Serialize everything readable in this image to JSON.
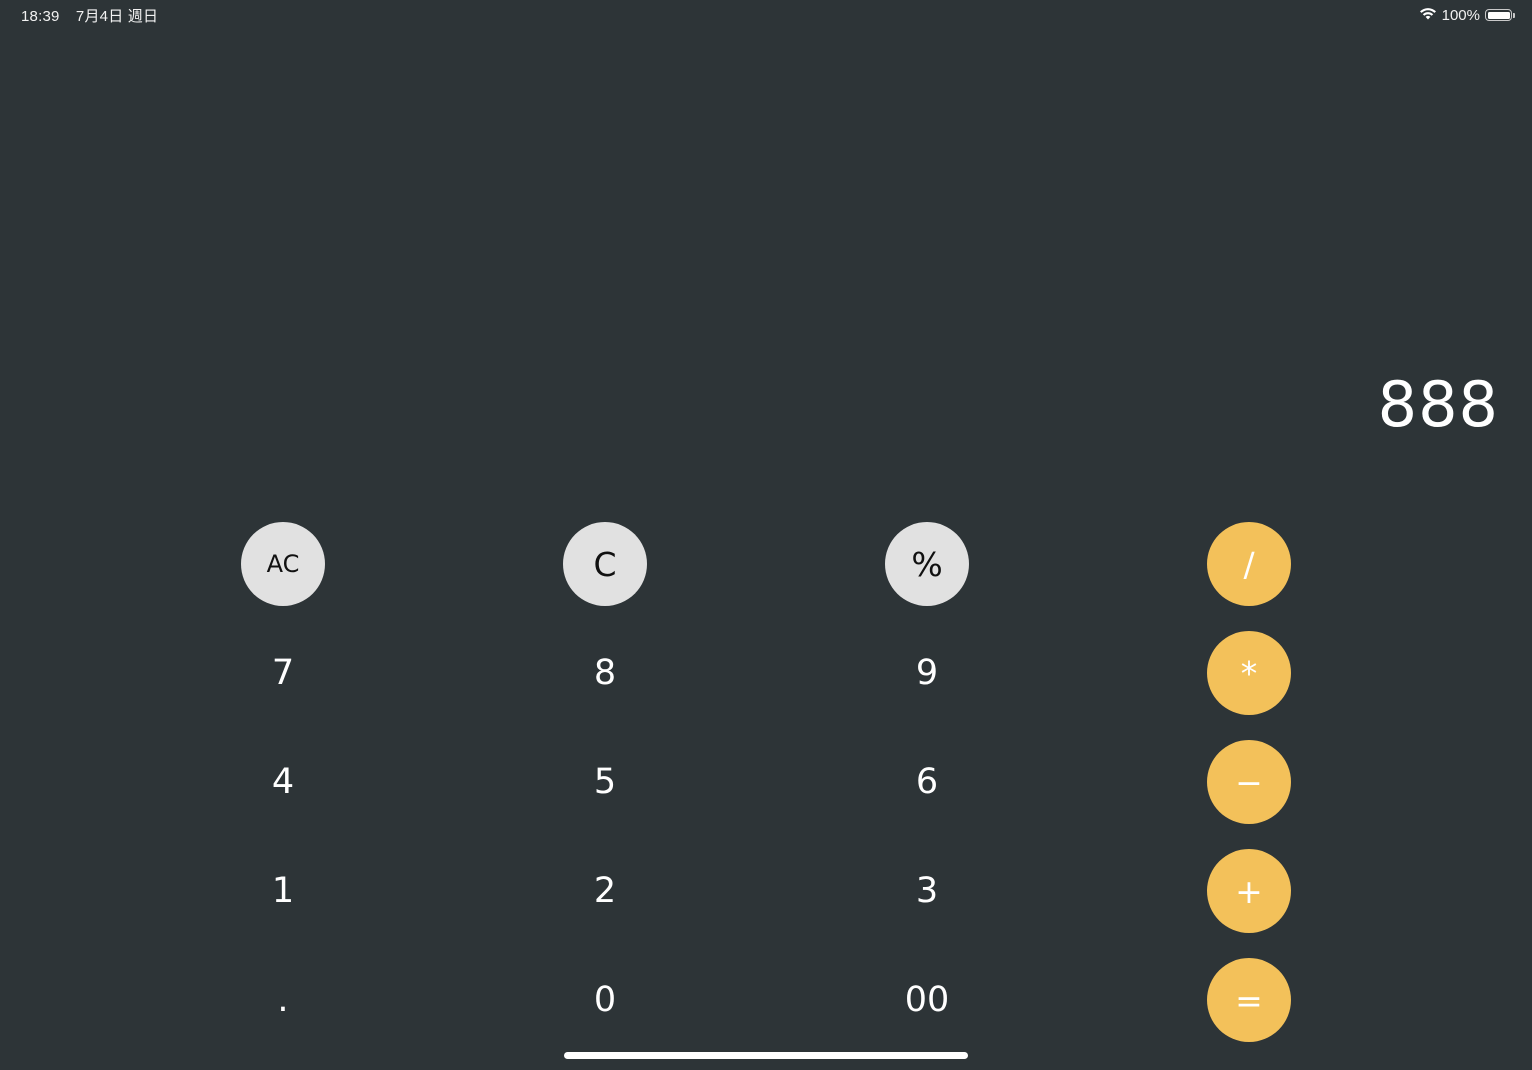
{
  "status_bar": {
    "time": "18:39",
    "date": "7月4日 週日",
    "battery_text": "100%",
    "icons": [
      "wifi-icon",
      "battery-icon"
    ]
  },
  "display": {
    "value": "888"
  },
  "keys": {
    "ac": "AC",
    "c": "C",
    "percent": "%",
    "divide": "/",
    "seven": "7",
    "eight": "8",
    "nine": "9",
    "multiply": "*",
    "four": "4",
    "five": "5",
    "six": "6",
    "minus": "−",
    "one": "1",
    "two": "2",
    "three": "3",
    "plus": "+",
    "dot": ".",
    "zero": "0",
    "double_zero": "00",
    "equals": "="
  },
  "colors": {
    "background": "#2d3437",
    "function_key": "#e1e1e1",
    "operator_key": "#f3c15a",
    "digit_text": "#ffffff"
  }
}
